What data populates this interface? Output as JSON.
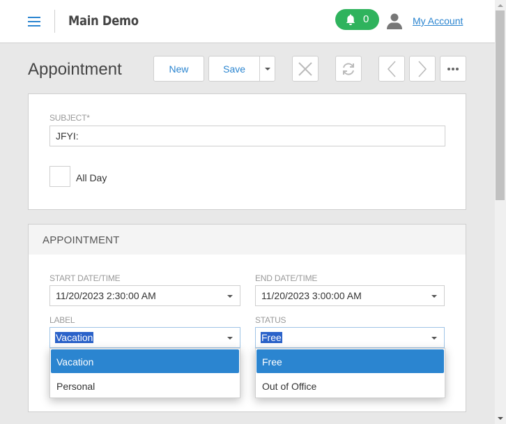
{
  "header": {
    "app_title": "Main Demo",
    "notifications_count": "0",
    "account_link": "My Account",
    "icons": {
      "menu": "hamburger-icon",
      "notifications": "bell-icon",
      "user": "user-icon"
    },
    "colors": {
      "accent": "#2b85d0",
      "notification_badge": "#2fb35d"
    }
  },
  "toolbar": {
    "page_title": "Appointment",
    "new_label": "New",
    "save_label": "Save",
    "icons": {
      "save_menu": "caret-down-icon",
      "close": "close-icon",
      "refresh": "refresh-icon",
      "previous": "chevron-left-icon",
      "next": "chevron-right-icon",
      "more": "more-icon"
    }
  },
  "general": {
    "subject_label": "SUBJECT*",
    "subject_value": "JFYI:",
    "all_day_label": "All Day",
    "all_day_checked": false
  },
  "appointment": {
    "section_title": "APPOINTMENT",
    "start_label": "START DATE/TIME",
    "start_value": "11/20/2023 2:30:00 AM",
    "end_label": "END DATE/TIME",
    "end_value": "11/20/2023 3:00:00 AM",
    "label_label": "LABEL",
    "label_value": "Vacation",
    "label_options": [
      "Vacation",
      "Personal"
    ],
    "status_label": "STATUS",
    "status_value": "Free",
    "status_options": [
      "Free",
      "Out of Office"
    ]
  }
}
